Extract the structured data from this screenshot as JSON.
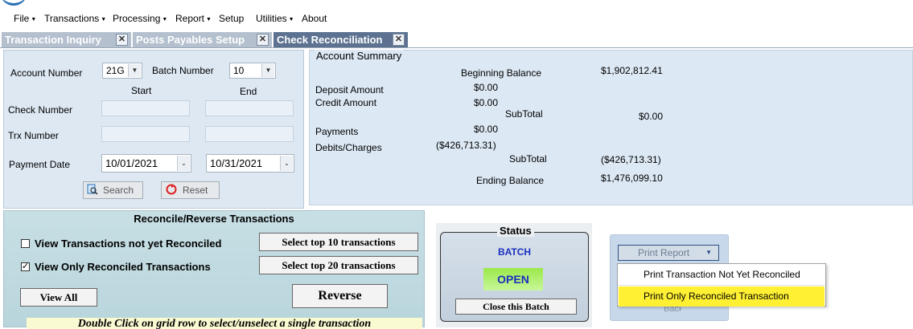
{
  "menubar": {
    "items": [
      {
        "label": "File",
        "has_caret": true
      },
      {
        "label": "Transactions",
        "has_caret": true
      },
      {
        "label": "Processing",
        "has_caret": true
      },
      {
        "label": "Report",
        "has_caret": true
      },
      {
        "label": "Setup",
        "has_caret": false
      },
      {
        "label": "Utilities",
        "has_caret": true
      },
      {
        "label": "About",
        "has_caret": false
      }
    ]
  },
  "tabs": [
    {
      "label": "Transaction Inquiry",
      "active": false
    },
    {
      "label": "Posts Payables Setup",
      "active": false
    },
    {
      "label": "Check Reconciliation",
      "active": true
    }
  ],
  "criteria": {
    "account_number_label": "Account Number",
    "account_number_value": "21G",
    "batch_number_label": "Batch Number",
    "batch_number_value": "10",
    "start_label": "Start",
    "end_label": "End",
    "check_number_label": "Check Number",
    "trx_number_label": "Trx Number",
    "payment_date_label": "Payment Date",
    "payment_date_start": "10/01/2021",
    "payment_date_end": "10/31/2021",
    "search_label": "Search",
    "reset_label": "Reset"
  },
  "summary": {
    "title": "Account Summary",
    "beginning_balance_label": "Beginning Balance",
    "beginning_balance": "$1,902,812.41",
    "deposit_amount_label": "Deposit Amount",
    "deposit_amount": "$0.00",
    "credit_amount_label": "Credit Amount",
    "credit_amount": "$0.00",
    "subtotal1_label": "SubTotal",
    "subtotal1": "$0.00",
    "payments_label": "Payments",
    "payments": "$0.00",
    "debits_label": "Debits/Charges",
    "debits": "($426,713.31)",
    "subtotal2_label": "SubTotal",
    "subtotal2": "($426,713.31)",
    "ending_balance_label": "Ending Balance",
    "ending_balance": "$1,476,099.10"
  },
  "reconcile": {
    "title": "Reconcile/Reverse Transactions",
    "not_reconciled_label": "View Transactions not yet Reconciled",
    "not_reconciled_checked": false,
    "only_reconciled_label": "View Only Reconciled Transactions",
    "only_reconciled_checked": true,
    "top10_label": "Select top 10 transactions",
    "top20_label": "Select top 20 transactions",
    "view_all_label": "View All",
    "reverse_label": "Reverse",
    "hint": "Double Click on grid row to select/unselect a single transaction"
  },
  "status": {
    "title": "Status",
    "batch_label": "BATCH",
    "state": "OPEN",
    "close_batch_label": "Close this Batch"
  },
  "print_report": {
    "button_label": "Print Report",
    "options": [
      {
        "label": "Print Transaction Not Yet Reconciled",
        "highlighted": false
      },
      {
        "label": "Print Only Reconciled Transaction",
        "highlighted": true
      }
    ],
    "hidden_button_label": "Back"
  },
  "colors": {
    "active_tab": "#5c7290",
    "inactive_tab": "#b4c0ce",
    "panel_bg": "#dde8f3",
    "open_badge": "#9be84a",
    "highlight": "#fff033",
    "batch_text": "#1a2fbf"
  }
}
